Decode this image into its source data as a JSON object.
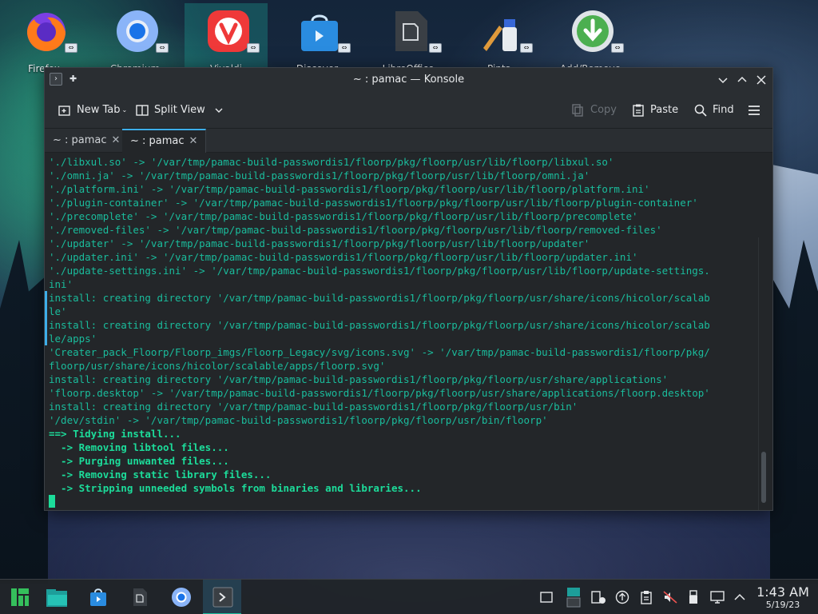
{
  "desktop": {
    "icons": [
      {
        "label": "Firefox"
      },
      {
        "label": "Chromium"
      },
      {
        "label": "Vivaldi"
      },
      {
        "label": "Discover"
      },
      {
        "label": "LibreOffice"
      },
      {
        "label": "Pinta"
      },
      {
        "label": "Add/Remove"
      }
    ]
  },
  "window": {
    "title": "~ : pamac — Konsole",
    "toolbar": {
      "new_tab": "New Tab",
      "split_view": "Split View",
      "copy": "Copy",
      "paste": "Paste",
      "find": "Find"
    },
    "tabs": [
      {
        "label": "~ : pamac"
      },
      {
        "label": "~ : pamac"
      }
    ],
    "terminal_lines": [
      "'./libxul.so' -> '/var/tmp/pamac-build-passwordis1/floorp/pkg/floorp/usr/lib/floorp/libxul.so'",
      "'./omni.ja' -> '/var/tmp/pamac-build-passwordis1/floorp/pkg/floorp/usr/lib/floorp/omni.ja'",
      "'./platform.ini' -> '/var/tmp/pamac-build-passwordis1/floorp/pkg/floorp/usr/lib/floorp/platform.ini'",
      "'./plugin-container' -> '/var/tmp/pamac-build-passwordis1/floorp/pkg/floorp/usr/lib/floorp/plugin-container'",
      "'./precomplete' -> '/var/tmp/pamac-build-passwordis1/floorp/pkg/floorp/usr/lib/floorp/precomplete'",
      "'./removed-files' -> '/var/tmp/pamac-build-passwordis1/floorp/pkg/floorp/usr/lib/floorp/removed-files'",
      "'./updater' -> '/var/tmp/pamac-build-passwordis1/floorp/pkg/floorp/usr/lib/floorp/updater'",
      "'./updater.ini' -> '/var/tmp/pamac-build-passwordis1/floorp/pkg/floorp/usr/lib/floorp/updater.ini'",
      "'./update-settings.ini' -> '/var/tmp/pamac-build-passwordis1/floorp/pkg/floorp/usr/lib/floorp/update-settings.",
      "ini'",
      "install: creating directory '/var/tmp/pamac-build-passwordis1/floorp/pkg/floorp/usr/share/icons/hicolor/scalab",
      "le'",
      "install: creating directory '/var/tmp/pamac-build-passwordis1/floorp/pkg/floorp/usr/share/icons/hicolor/scalab",
      "le/apps'",
      "'Creater_pack_Floorp/Floorp_imgs/Floorp_Legacy/svg/icons.svg' -> '/var/tmp/pamac-build-passwordis1/floorp/pkg/",
      "floorp/usr/share/icons/hicolor/scalable/apps/floorp.svg'",
      "install: creating directory '/var/tmp/pamac-build-passwordis1/floorp/pkg/floorp/usr/share/applications'",
      "'floorp.desktop' -> '/var/tmp/pamac-build-passwordis1/floorp/pkg/floorp/usr/share/applications/floorp.desktop'",
      "install: creating directory '/var/tmp/pamac-build-passwordis1/floorp/pkg/floorp/usr/bin'",
      "'/dev/stdin' -> '/var/tmp/pamac-build-passwordis1/floorp/pkg/floorp/usr/bin/floorp'"
    ],
    "status_lines": [
      "==> Tidying install...",
      "  -> Removing libtool files...",
      "  -> Purging unwanted files...",
      "  -> Removing static library files...",
      "  -> Stripping unneeded symbols from binaries and libraries..."
    ]
  },
  "taskbar": {
    "clock_time": "1:43 AM",
    "clock_date": "5/19/23"
  },
  "colors": {
    "accent": "#3daee9",
    "terminal_text": "#1abc9c",
    "window_bg": "#232629"
  }
}
